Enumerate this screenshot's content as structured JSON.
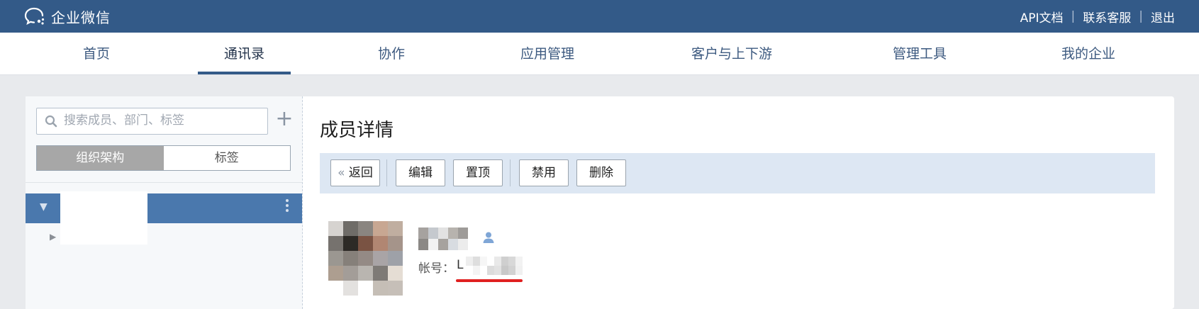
{
  "brand": {
    "name": "企业微信"
  },
  "top_links": [
    "API文档",
    "联系客服",
    "退出"
  ],
  "nav": {
    "items": [
      "首页",
      "通讯录",
      "协作",
      "应用管理",
      "客户与上下游",
      "管理工具",
      "我的企业"
    ],
    "active": "通讯录"
  },
  "sidebar": {
    "search_placeholder": "搜索成员、部门、标签",
    "add_symbol": "+",
    "tabs": [
      "组织架构",
      "标签"
    ],
    "active_tab": "组织架构"
  },
  "member": {
    "title": "成员详情",
    "toolbar": {
      "back": "返回",
      "edit": "编辑",
      "pin": "置顶",
      "disable": "禁用",
      "delete": "删除"
    },
    "account_label": "帐号：",
    "account_value_visible": "L"
  },
  "colors": {
    "header": "#335a88",
    "accent": "#4a78ad",
    "toolbar_bg": "#dde7f3",
    "highlight_line": "#e02020"
  }
}
